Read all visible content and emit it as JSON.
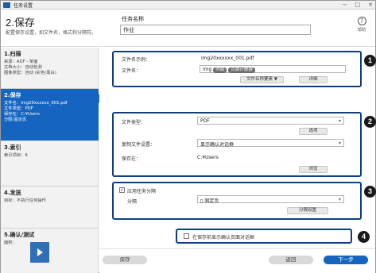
{
  "window": {
    "title": "任务设置",
    "controls": [
      "−",
      "□",
      "✕"
    ]
  },
  "header": {
    "title": "2.保存",
    "subtitle": "配置保存设置，如文件名，格式和分隔符。",
    "task_name_label": "任务名称",
    "task_name_value": "作业",
    "help_label": "帮助",
    "help_icon": "?"
  },
  "sidebar": {
    "steps": [
      {
        "title": "1.扫描",
        "lines": [
          "来源：ADF - 单面",
          "文档大小：自动检测",
          "图像类型：自动 (彩色/黑白)"
        ]
      },
      {
        "title": "2.保存",
        "lines": [
          "文件名：img20xxxxxx_001.pdf",
          "文件类型：PDF",
          "保存在：C:¥Users",
          "分隔 固定页"
        ]
      },
      {
        "title": "3.索引",
        "lines": [
          "索引项目：6"
        ]
      },
      {
        "title": "4.发送",
        "lines": [
          "目标：不执行任何操作"
        ]
      },
      {
        "title": "5.确认/测试",
        "lines": [
          "面积："
        ]
      }
    ]
  },
  "group1": {
    "example_label": "文件名示例：",
    "example_value": "img20xxxxxx_001.pdf",
    "filename_label": "文件名：",
    "filename_prefix": "img",
    "token1": "时戳",
    "token2": "页面计数器",
    "elements_button": "文件名称要素 ▼",
    "detail_button": "详细"
  },
  "group2": {
    "filetype_label": "文件类型：",
    "filetype_value": "PDF",
    "options_button": "选项",
    "duplicate_label": "复制文件设置：",
    "duplicate_value": "显示确认对话框",
    "savein_label": "保存在：",
    "savein_value": "C:¥Users",
    "browse_button": "浏览"
  },
  "group3": {
    "apply_label": "应用任务分隔",
    "apply_checked": "✓",
    "separator_label": "分隔",
    "separator_value": "固定页",
    "separator_button": "分隔设置"
  },
  "group4": {
    "confirm_label": "在保存前显示确认页面对话框"
  },
  "callouts": [
    "1",
    "2",
    "3",
    "4"
  ],
  "footer": {
    "save_button": "保存",
    "back_button": "返回",
    "next_button": "下一步"
  },
  "colors": {
    "accent": "#1565c0",
    "group_border": "#0d3f7e",
    "callout": "#1a1a1a"
  }
}
